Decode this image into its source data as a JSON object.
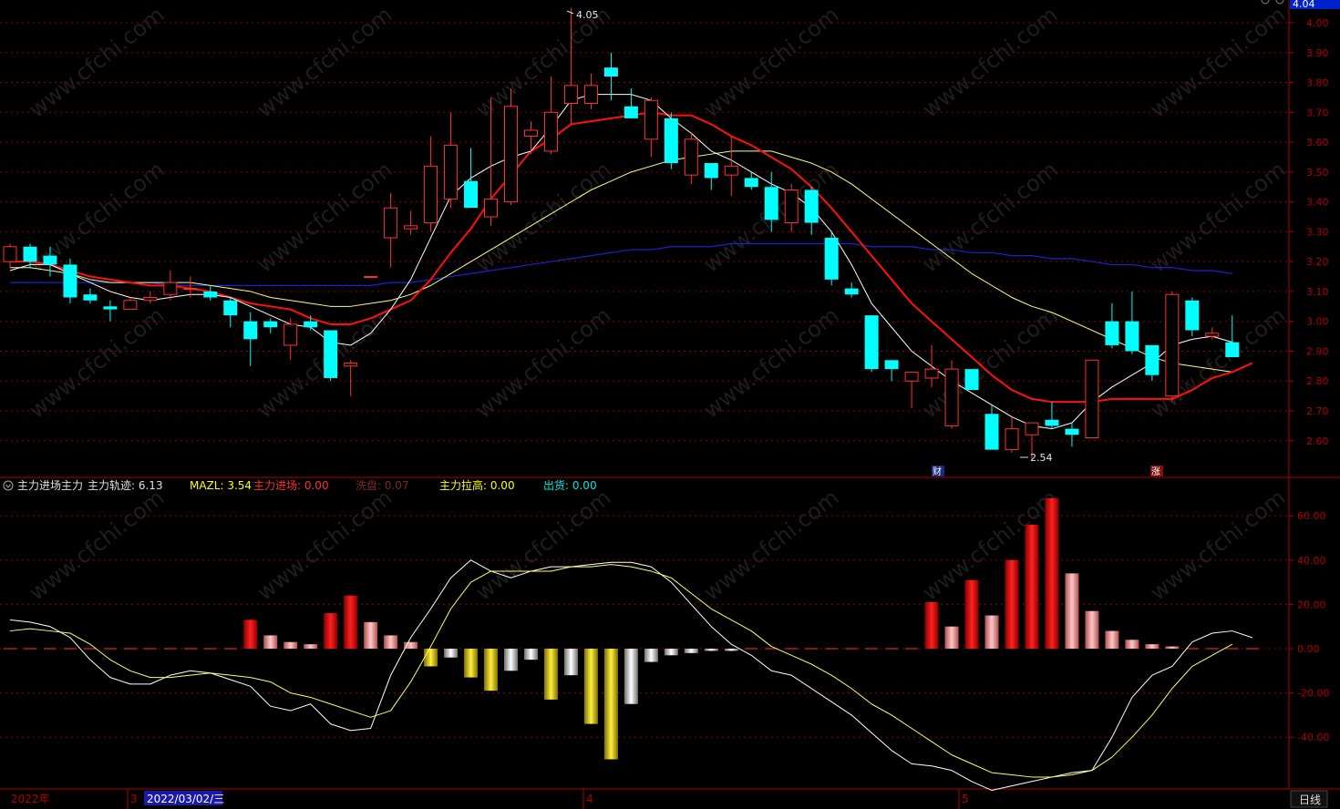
{
  "title_bar": {
    "label": "",
    "y_axis_top_value": "4.04"
  },
  "indicator_bar": {
    "name": "主力进场主力",
    "items": [
      {
        "label": "主力轨迹:",
        "value": "6.13",
        "color": "#e0e0e0"
      },
      {
        "label": "MAZL:",
        "value": "3.54",
        "color": "#ffff00"
      },
      {
        "label": "主力进场:",
        "value": "0.00",
        "color": "#ff3030"
      },
      {
        "label": "洗盘:",
        "value": "0.07",
        "color": "#7a2a2a"
      },
      {
        "label": "主力拉高:",
        "value": "0.00",
        "color": "#ffff00"
      },
      {
        "label": "出货:",
        "value": "0.00",
        "color": "#00e5e5"
      }
    ]
  },
  "bottom_bar": {
    "year_label": "2022年",
    "month_3": "3",
    "cursor_date": "2022/03/02/三",
    "month_4": "4",
    "month_5": "5",
    "period_button": "日线"
  },
  "markers": {
    "cai": "财",
    "zhang": "涨"
  },
  "watermark": "www.cfchi.com",
  "colors": {
    "up": "#ff3030",
    "down": "#00ffff",
    "ma_fast": "#ffffff",
    "ma_mid": "#ff1010",
    "ma_slow": "#ffff80",
    "ma_long": "#2020d0",
    "grid": "#8b0000"
  },
  "chart_data": [
    {
      "type": "candlestick",
      "ylim": [
        2.5,
        4.05
      ],
      "y_ticks": [
        "4.00",
        "3.90",
        "3.80",
        "3.70",
        "3.60",
        "3.50",
        "3.40",
        "3.30",
        "3.20",
        "3.10",
        "3.00",
        "2.90",
        "2.80",
        "2.70",
        "2.60"
      ],
      "annotations": {
        "high_label": "4.05",
        "low_label": "2.54"
      },
      "candles": [
        {
          "o": 3.2,
          "h": 3.26,
          "l": 3.18,
          "c": 3.25
        },
        {
          "o": 3.2,
          "h": 3.26,
          "l": 3.18,
          "c": 3.25,
          "d": 1
        },
        {
          "o": 3.22,
          "h": 3.25,
          "l": 3.15,
          "c": 3.19,
          "d": 1
        },
        {
          "o": 3.19,
          "h": 3.21,
          "l": 3.06,
          "c": 3.08,
          "d": 1
        },
        {
          "o": 3.09,
          "h": 3.11,
          "l": 3.06,
          "c": 3.07,
          "d": 1
        },
        {
          "o": 3.05,
          "h": 3.07,
          "l": 3.0,
          "c": 3.04,
          "d": 1
        },
        {
          "o": 3.04,
          "h": 3.08,
          "l": 3.04,
          "c": 3.07
        },
        {
          "o": 3.07,
          "h": 3.1,
          "l": 3.06,
          "c": 3.08
        },
        {
          "o": 3.09,
          "h": 3.17,
          "l": 3.07,
          "c": 3.13
        },
        {
          "o": 3.11,
          "h": 3.15,
          "l": 3.08,
          "c": 3.11
        },
        {
          "o": 3.1,
          "h": 3.12,
          "l": 3.07,
          "c": 3.08,
          "d": 1
        },
        {
          "o": 3.07,
          "h": 3.08,
          "l": 2.98,
          "c": 3.02,
          "d": 1
        },
        {
          "o": 3.0,
          "h": 3.03,
          "l": 2.85,
          "c": 2.94,
          "d": 1
        },
        {
          "o": 3.0,
          "h": 3.01,
          "l": 2.96,
          "c": 2.98,
          "d": 1
        },
        {
          "o": 2.92,
          "h": 3.01,
          "l": 2.87,
          "c": 2.99
        },
        {
          "o": 3.0,
          "h": 3.02,
          "l": 2.97,
          "c": 2.98,
          "d": 1
        },
        {
          "o": 2.97,
          "h": 2.97,
          "l": 2.8,
          "c": 2.81,
          "d": 1
        },
        {
          "o": 2.85,
          "h": 2.87,
          "l": 2.75,
          "c": 2.86
        },
        {
          "o": 3.15,
          "h": 3.15,
          "l": 3.15,
          "c": 3.15
        },
        {
          "o": 3.28,
          "h": 3.43,
          "l": 3.18,
          "c": 3.38
        },
        {
          "o": 3.31,
          "h": 3.37,
          "l": 3.29,
          "c": 3.32
        },
        {
          "o": 3.33,
          "h": 3.62,
          "l": 3.3,
          "c": 3.52
        },
        {
          "o": 3.41,
          "h": 3.7,
          "l": 3.38,
          "c": 3.59
        },
        {
          "o": 3.47,
          "h": 3.58,
          "l": 3.44,
          "c": 3.38,
          "d": 1
        },
        {
          "o": 3.41,
          "h": 3.75,
          "l": 3.32,
          "c": 3.35
        },
        {
          "o": 3.4,
          "h": 3.78,
          "l": 3.39,
          "c": 3.72
        },
        {
          "o": 3.64,
          "h": 3.67,
          "l": 3.56,
          "c": 3.62
        },
        {
          "o": 3.57,
          "h": 3.82,
          "l": 3.56,
          "c": 3.7
        },
        {
          "o": 3.73,
          "h": 4.05,
          "l": 3.66,
          "c": 3.79
        },
        {
          "o": 3.73,
          "h": 3.83,
          "l": 3.71,
          "c": 3.79
        },
        {
          "o": 3.82,
          "h": 3.9,
          "l": 3.74,
          "c": 3.85,
          "d": 1
        },
        {
          "o": 3.72,
          "h": 3.78,
          "l": 3.68,
          "c": 3.68,
          "d": 1
        },
        {
          "o": 3.61,
          "h": 3.75,
          "l": 3.55,
          "c": 3.74
        },
        {
          "o": 3.68,
          "h": 3.7,
          "l": 3.51,
          "c": 3.53,
          "d": 1
        },
        {
          "o": 3.61,
          "h": 3.63,
          "l": 3.46,
          "c": 3.49
        },
        {
          "o": 3.53,
          "h": 3.53,
          "l": 3.44,
          "c": 3.48,
          "d": 1
        },
        {
          "o": 3.49,
          "h": 3.62,
          "l": 3.42,
          "c": 3.52
        },
        {
          "o": 3.48,
          "h": 3.5,
          "l": 3.44,
          "c": 3.45,
          "d": 1
        },
        {
          "o": 3.45,
          "h": 3.5,
          "l": 3.3,
          "c": 3.34,
          "d": 1
        },
        {
          "o": 3.33,
          "h": 3.46,
          "l": 3.3,
          "c": 3.44
        },
        {
          "o": 3.44,
          "h": 3.45,
          "l": 3.29,
          "c": 3.33,
          "d": 1
        },
        {
          "o": 3.28,
          "h": 3.3,
          "l": 3.12,
          "c": 3.14,
          "d": 1
        },
        {
          "o": 3.11,
          "h": 3.13,
          "l": 3.08,
          "c": 3.09,
          "d": 1
        },
        {
          "o": 3.02,
          "h": 3.02,
          "l": 2.83,
          "c": 2.84,
          "d": 1
        },
        {
          "o": 2.87,
          "h": 2.87,
          "l": 2.8,
          "c": 2.84,
          "d": 1
        },
        {
          "o": 2.8,
          "h": 2.83,
          "l": 2.71,
          "c": 2.83
        },
        {
          "o": 2.81,
          "h": 2.92,
          "l": 2.78,
          "c": 2.84
        },
        {
          "o": 2.84,
          "h": 2.87,
          "l": 2.64,
          "c": 2.65
        },
        {
          "o": 2.84,
          "h": 2.84,
          "l": 2.77,
          "c": 2.77,
          "d": 1
        },
        {
          "o": 2.69,
          "h": 2.72,
          "l": 2.57,
          "c": 2.57,
          "d": 1
        },
        {
          "o": 2.57,
          "h": 2.68,
          "l": 2.56,
          "c": 2.64
        },
        {
          "o": 2.62,
          "h": 2.66,
          "l": 2.54,
          "c": 2.66
        },
        {
          "o": 2.67,
          "h": 2.73,
          "l": 2.64,
          "c": 2.65,
          "d": 1
        },
        {
          "o": 2.64,
          "h": 2.66,
          "l": 2.58,
          "c": 2.62,
          "d": 1
        },
        {
          "o": 2.61,
          "h": 2.87,
          "l": 2.61,
          "c": 2.87
        },
        {
          "o": 3.0,
          "h": 3.06,
          "l": 2.91,
          "c": 2.92,
          "d": 1
        },
        {
          "o": 3.0,
          "h": 3.1,
          "l": 2.89,
          "c": 2.9,
          "d": 1
        },
        {
          "o": 2.92,
          "h": 2.92,
          "l": 2.8,
          "c": 2.82,
          "d": 1
        },
        {
          "o": 2.75,
          "h": 3.1,
          "l": 2.73,
          "c": 3.09
        },
        {
          "o": 3.07,
          "h": 3.08,
          "l": 2.95,
          "c": 2.97,
          "d": 1
        },
        {
          "o": 2.96,
          "h": 2.98,
          "l": 2.94,
          "c": 2.95
        },
        {
          "o": 2.93,
          "h": 3.02,
          "l": 2.88,
          "c": 2.88,
          "d": 1
        }
      ],
      "ma_fast": [
        3.17,
        3.19,
        3.19,
        3.16,
        3.13,
        3.1,
        3.08,
        3.07,
        3.08,
        3.09,
        3.09,
        3.08,
        3.05,
        3.02,
        2.99,
        2.98,
        2.93,
        2.92,
        2.96,
        3.04,
        3.14,
        3.28,
        3.42,
        3.48,
        3.52,
        3.55,
        3.57,
        3.65,
        3.74,
        3.76,
        3.76,
        3.76,
        3.74,
        3.68,
        3.63,
        3.57,
        3.54,
        3.5,
        3.46,
        3.43,
        3.38,
        3.3,
        3.19,
        3.06,
        2.98,
        2.9,
        2.85,
        2.8,
        2.76,
        2.72,
        2.68,
        2.65,
        2.64,
        2.66,
        2.73,
        2.78,
        2.82,
        2.86,
        2.92,
        2.94,
        2.95,
        2.93
      ],
      "ma_mid": [
        3.2,
        3.2,
        3.19,
        3.17,
        3.15,
        3.14,
        3.13,
        3.12,
        3.12,
        3.11,
        3.1,
        3.08,
        3.06,
        3.05,
        3.04,
        3.01,
        2.99,
        2.99,
        3.01,
        3.04,
        3.07,
        3.14,
        3.23,
        3.31,
        3.41,
        3.49,
        3.57,
        3.61,
        3.66,
        3.67,
        3.68,
        3.69,
        3.7,
        3.69,
        3.69,
        3.66,
        3.62,
        3.59,
        3.55,
        3.51,
        3.45,
        3.38,
        3.3,
        3.22,
        3.14,
        3.06,
        3.0,
        2.94,
        2.88,
        2.82,
        2.77,
        2.74,
        2.73,
        2.73,
        2.73,
        2.74,
        2.74,
        2.74,
        2.74,
        2.77,
        2.81,
        2.83,
        2.86
      ],
      "ma_slow": [
        3.18,
        3.18,
        3.17,
        3.16,
        3.14,
        3.13,
        3.13,
        3.13,
        3.13,
        3.13,
        3.12,
        3.11,
        3.1,
        3.08,
        3.07,
        3.06,
        3.05,
        3.05,
        3.06,
        3.07,
        3.09,
        3.12,
        3.16,
        3.2,
        3.24,
        3.28,
        3.32,
        3.36,
        3.4,
        3.44,
        3.47,
        3.5,
        3.52,
        3.54,
        3.55,
        3.56,
        3.57,
        3.57,
        3.57,
        3.55,
        3.53,
        3.5,
        3.46,
        3.41,
        3.36,
        3.31,
        3.26,
        3.21,
        3.16,
        3.12,
        3.08,
        3.05,
        3.03,
        3.0,
        2.97,
        2.94,
        2.91,
        2.88,
        2.86,
        2.85,
        2.84,
        2.83
      ],
      "ma_long": [
        3.13,
        3.13,
        3.13,
        3.13,
        3.13,
        3.13,
        3.13,
        3.13,
        3.12,
        3.12,
        3.12,
        3.12,
        3.12,
        3.12,
        3.12,
        3.12,
        3.12,
        3.12,
        3.12,
        3.13,
        3.13,
        3.14,
        3.15,
        3.16,
        3.17,
        3.18,
        3.19,
        3.2,
        3.21,
        3.22,
        3.23,
        3.24,
        3.24,
        3.25,
        3.25,
        3.25,
        3.26,
        3.26,
        3.26,
        3.26,
        3.26,
        3.26,
        3.26,
        3.25,
        3.25,
        3.25,
        3.24,
        3.24,
        3.23,
        3.23,
        3.22,
        3.22,
        3.21,
        3.21,
        3.2,
        3.19,
        3.19,
        3.18,
        3.18,
        3.17,
        3.17,
        3.16
      ]
    },
    {
      "type": "bar",
      "ylim": [
        -50,
        70
      ],
      "y_ticks": [
        "60.00",
        "40.00",
        "20.00",
        "0.00",
        "-20.00",
        "-40.00"
      ],
      "bars": [
        0,
        0,
        0,
        0,
        0,
        0,
        0,
        0,
        0,
        0,
        0,
        0,
        13,
        6,
        3,
        2,
        16,
        24,
        12,
        6,
        3,
        -8,
        -4,
        -13,
        -19,
        -10,
        -5,
        -23,
        -12,
        -34,
        -50,
        -25,
        -6,
        -3,
        -2,
        -1,
        -1,
        0,
        0,
        0,
        0,
        0,
        0,
        0,
        0,
        0,
        21,
        10,
        31,
        15,
        40,
        56,
        68,
        34,
        17,
        8,
        4,
        2,
        1,
        0,
        0,
        0,
        0
      ],
      "bar_styles": [
        "r",
        "r",
        "r",
        "r",
        "r",
        "r",
        "r",
        "r",
        "r",
        "r",
        "r",
        "r",
        "r",
        "p",
        "p",
        "p",
        "r",
        "r",
        "p",
        "p",
        "p",
        "y",
        "w",
        "y",
        "y",
        "w",
        "w",
        "y",
        "w",
        "y",
        "y",
        "w",
        "w",
        "w",
        "w",
        "w",
        "w",
        "w",
        "w",
        "w",
        "w",
        "w",
        "w",
        "w",
        "w",
        "w",
        "r",
        "p",
        "r",
        "p",
        "r",
        "r",
        "r",
        "p",
        "p",
        "p",
        "p",
        "p",
        "p",
        "p",
        "p",
        "p",
        "p"
      ],
      "line_white": [
        13,
        12,
        10,
        5,
        -5,
        -13,
        -16,
        -16,
        -12,
        -10,
        -11,
        -14,
        -17,
        -26,
        -28,
        -25,
        -34,
        -37,
        -36,
        -12,
        5,
        18,
        32,
        40,
        35,
        32,
        35,
        37,
        37,
        38,
        39,
        39,
        37,
        30,
        20,
        10,
        2,
        -3,
        -10,
        -12,
        -18,
        -24,
        -30,
        -38,
        -46,
        -52,
        -53,
        -55,
        -60,
        -64,
        -62,
        -60,
        -58,
        -56,
        -55,
        -40,
        -22,
        -12,
        -8,
        3,
        7,
        8,
        5
      ],
      "line_yellow": [
        8,
        9,
        8,
        7,
        2,
        -5,
        -10,
        -13,
        -13,
        -12,
        -11,
        -12,
        -13,
        -15,
        -20,
        -22,
        -25,
        -28,
        -31,
        -28,
        -15,
        1,
        18,
        30,
        35,
        35,
        35,
        35,
        37,
        37,
        38,
        37,
        35,
        32,
        25,
        18,
        13,
        8,
        1,
        -3,
        -7,
        -12,
        -18,
        -25,
        -30,
        -36,
        -42,
        -48,
        -52,
        -56,
        -57,
        -58,
        -58,
        -57,
        -55,
        -49,
        -40,
        -30,
        -18,
        -8,
        -3,
        2
      ]
    }
  ]
}
